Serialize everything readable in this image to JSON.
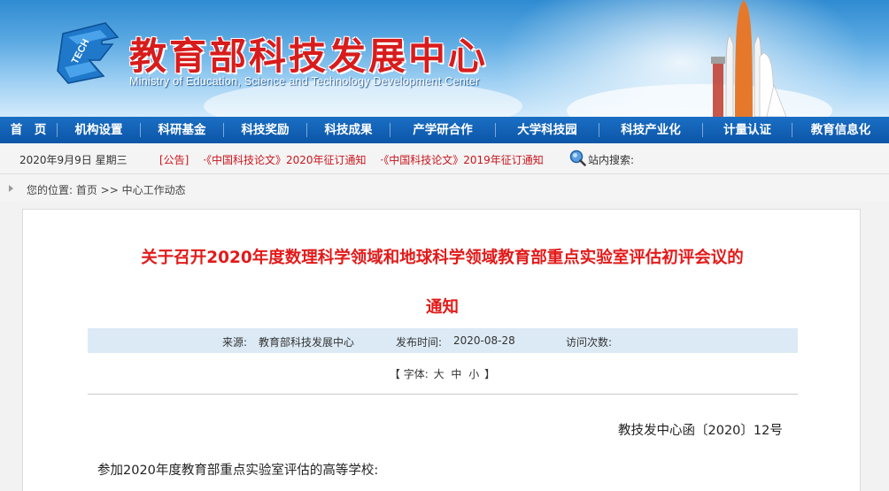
{
  "header": {
    "title": "教育部科技发展中心",
    "subtitle": "Ministry of Education, Science and Technology Development Center",
    "logo_text": "TECH"
  },
  "nav": [
    {
      "label": "首　页",
      "name": "nav-home"
    },
    {
      "label": "机构设置",
      "name": "nav-organization"
    },
    {
      "label": "科研基金",
      "name": "nav-research-fund"
    },
    {
      "label": "科技奖励",
      "name": "nav-awards"
    },
    {
      "label": "科技成果",
      "name": "nav-achievements"
    },
    {
      "label": "产学研合作",
      "name": "nav-cooperation"
    },
    {
      "label": "大学科技园",
      "name": "nav-science-park"
    },
    {
      "label": "科技产业化",
      "name": "nav-industrialization"
    },
    {
      "label": "计量认证",
      "name": "nav-certification"
    },
    {
      "label": "教育信息化",
      "name": "nav-informatization"
    }
  ],
  "infobar": {
    "date": "2020年9月9日  星期三",
    "notice_tag": "[公告]",
    "notices": [
      "·《中国科技论文》2020年征订通知",
      "·《中国科技论文》2019年征订通知"
    ],
    "search_label": "站内搜索:"
  },
  "breadcrumb": {
    "text": "您的位置: 首页 >> 中心工作动态"
  },
  "article": {
    "title_line1": "关于召开2020年度数理科学领域和地球科学领域教育部重点实验室评估初评会议的",
    "title_line2": "通知",
    "source_label": "来源:",
    "source": "教育部科技发展中心",
    "date_label": "发布时间:",
    "date": "2020-08-28",
    "visits_label": "访问次数:",
    "fontsize_open": "【 字体:",
    "fontsize_large": "大",
    "fontsize_medium": "中",
    "fontsize_small": "小",
    "fontsize_close": "】",
    "doc_number": "教技发中心函〔2020〕12号",
    "greeting": "参加2020年度教育部重点实验室评估的高等学校:"
  },
  "colors": {
    "nav_bg": "#0c55a8",
    "title_red": "#e21a1a",
    "meta_bg": "#dceaf5"
  }
}
